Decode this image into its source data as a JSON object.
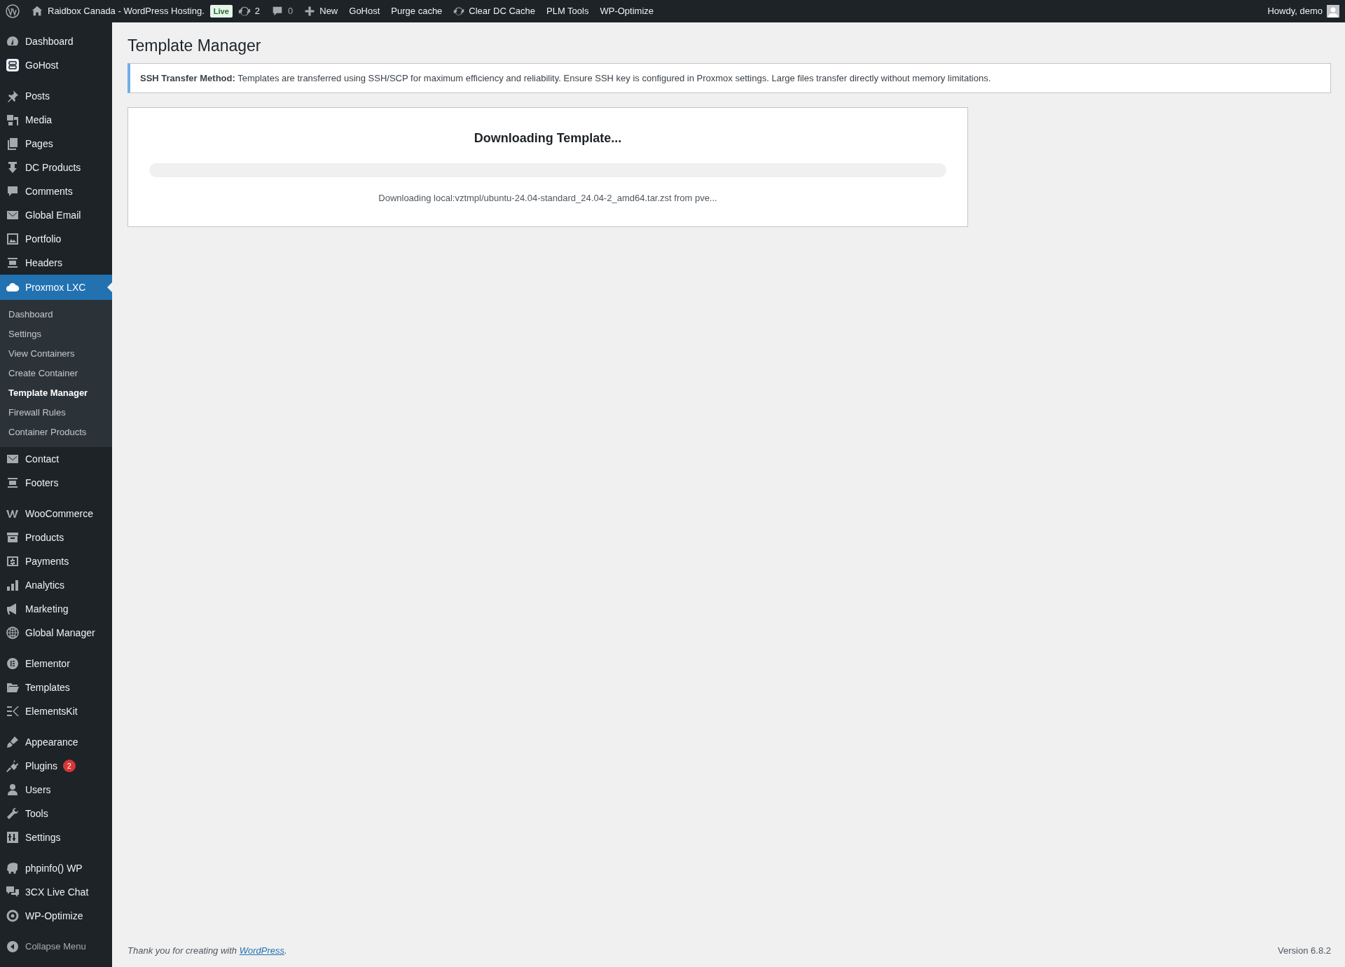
{
  "admin_bar": {
    "site_name": "Raidbox Canada - WordPress Hosting.",
    "live_badge": "Live",
    "updates_count": "2",
    "comments_count": "0",
    "items": [
      {
        "kind": "new",
        "label": "New"
      },
      {
        "kind": "plain",
        "label": "GoHost"
      },
      {
        "kind": "plain",
        "label": "Purge cache"
      },
      {
        "kind": "refresh",
        "label": "Clear DC Cache"
      },
      {
        "kind": "plain",
        "label": "PLM Tools"
      },
      {
        "kind": "plain",
        "label": "WP-Optimize"
      }
    ],
    "greeting": "Howdy, demo"
  },
  "sidebar": {
    "groups": [
      [
        {
          "label": "Dashboard",
          "current": false
        },
        {
          "label": "GoHost",
          "current": false
        }
      ],
      [
        {
          "label": "Posts",
          "current": false
        },
        {
          "label": "Media",
          "current": false
        },
        {
          "label": "Pages",
          "current": false
        },
        {
          "label": "DC Products",
          "current": false
        },
        {
          "label": "Comments",
          "current": false
        },
        {
          "label": "Global Email",
          "current": false
        },
        {
          "label": "Portfolio",
          "current": false
        },
        {
          "label": "Headers",
          "current": false
        },
        {
          "label": "Proxmox LXC",
          "current": true,
          "submenu": [
            {
              "label": "Dashboard",
              "selected": false
            },
            {
              "label": "Settings",
              "selected": false
            },
            {
              "label": "View Containers",
              "selected": false
            },
            {
              "label": "Create Container",
              "selected": false
            },
            {
              "label": "Template Manager",
              "selected": true
            },
            {
              "label": "Firewall Rules",
              "selected": false
            },
            {
              "label": "Container Products",
              "selected": false
            }
          ]
        },
        {
          "label": "Contact",
          "current": false
        },
        {
          "label": "Footers",
          "current": false
        }
      ],
      [
        {
          "label": "WooCommerce",
          "current": false
        },
        {
          "label": "Products",
          "current": false
        },
        {
          "label": "Payments",
          "current": false
        },
        {
          "label": "Analytics",
          "current": false
        },
        {
          "label": "Marketing",
          "current": false
        },
        {
          "label": "Global Manager",
          "current": false
        }
      ],
      [
        {
          "label": "Elementor",
          "current": false
        },
        {
          "label": "Templates",
          "current": false
        },
        {
          "label": "ElementsKit",
          "current": false
        }
      ],
      [
        {
          "label": "Appearance",
          "current": false
        },
        {
          "label": "Plugins",
          "current": false,
          "badge": "2"
        },
        {
          "label": "Users",
          "current": false
        },
        {
          "label": "Tools",
          "current": false
        },
        {
          "label": "Settings",
          "current": false
        }
      ],
      [
        {
          "label": "phpinfo() WP",
          "current": false
        },
        {
          "label": "3CX Live Chat",
          "current": false
        },
        {
          "label": "WP-Optimize",
          "current": false
        }
      ]
    ],
    "collapse": "Collapse Menu"
  },
  "page": {
    "title": "Template Manager",
    "notice": "**SSH Transfer Method:** Templates are transferred using SSH/SCP for maximum efficiency and reliability. Ensure SSH key is configured in Proxmox settings. Large files transfer directly without memory limitations.",
    "download": {
      "title": "Downloading Template...",
      "level": 0,
      "status": "Downloading local:vztmpl/ubuntu-24.04-standard_24.04-2_amd64.tar.zst from pve..."
    }
  },
  "footer": {
    "thanks_before": "Thank you for creating with ",
    "thanks_link": "WordPress",
    "thanks_after": ".",
    "version": "Version 6.8.2"
  }
}
